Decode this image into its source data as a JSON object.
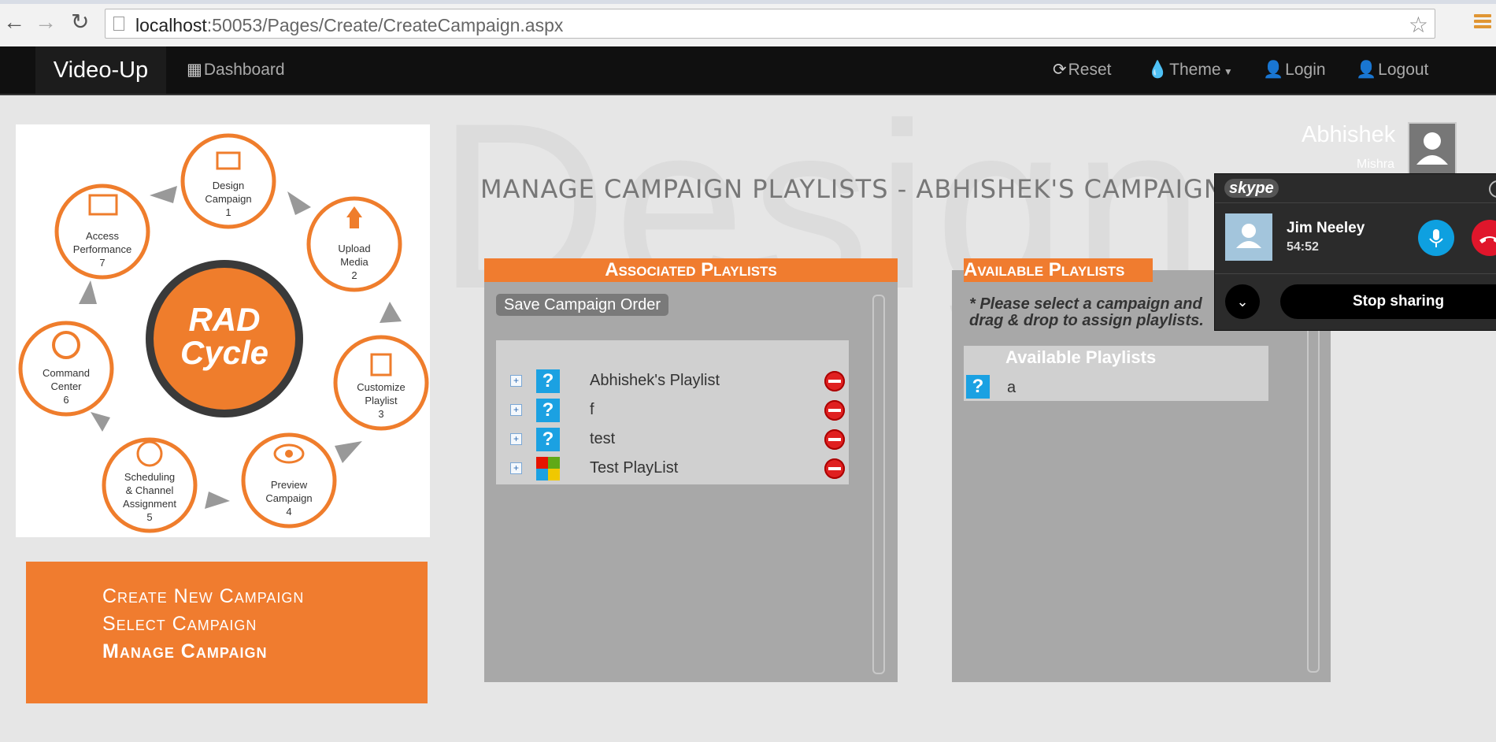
{
  "browser": {
    "url_host": "localhost",
    "url_rest": ":50053/Pages/Create/CreateCampaign.aspx",
    "back_icon": "arrow-left-icon",
    "forward_icon": "arrow-right-icon",
    "reload_icon": "reload-icon",
    "bookmark_icon": "star-icon"
  },
  "navbar": {
    "brand": "Video-Up",
    "dashboard": "Dashboard",
    "reset": "Reset",
    "theme": "Theme",
    "login": "Login",
    "logout": "Logout"
  },
  "watermark": "Design",
  "rad_image": {
    "center_line1": "RAD",
    "center_line2": "Cycle",
    "steps": [
      {
        "line1": "Design",
        "line2": "Campaign",
        "num": "1"
      },
      {
        "line1": "Upload",
        "line2": "Media",
        "num": "2"
      },
      {
        "line1": "Customize",
        "line2": "Playlist",
        "num": "3"
      },
      {
        "line1": "Preview",
        "line2": "Campaign",
        "num": "4"
      },
      {
        "line1": "Scheduling",
        "line2": "& Channel",
        "line3": "Assignment",
        "num": "5"
      },
      {
        "line1": "Command",
        "line2": "Center",
        "num": "6"
      },
      {
        "line1": "Access",
        "line2": "Performance",
        "num": "7"
      }
    ]
  },
  "campaign_menu": {
    "create": "Create New Campaign",
    "select": "Select Campaign",
    "manage": "Manage Campaign"
  },
  "page_title": "MANAGE CAMPAIGN PLAYLISTS    - ABHISHEK'S CAMPAIGN",
  "associated": {
    "header": "Associated Playlists",
    "save_button": "Save Campaign Order",
    "playlists": [
      {
        "name": "Abhishek's Playlist",
        "thumb": "?"
      },
      {
        "name": "f",
        "thumb": "?"
      },
      {
        "name": "test",
        "thumb": "?"
      },
      {
        "name": "Test PlayList",
        "thumb": "tiles"
      }
    ]
  },
  "available": {
    "header": "Available Playlists",
    "instruction_line1": "* Please select a campaign and",
    "instruction_line2": "drag & drop to assign playlists.",
    "box_header": "Available Playlists",
    "items": [
      {
        "name": "a",
        "thumb": "?"
      }
    ]
  },
  "user": {
    "name": "Abhishek",
    "sub": "Mishra"
  },
  "skype": {
    "logo": "skype",
    "caller": "Jim Neeley",
    "duration": "54:52",
    "stop_sharing": "Stop sharing"
  },
  "colors": {
    "accent": "#f07c2f",
    "navbar": "#101010",
    "panel": "#a8a8a8",
    "tile_blue": "#1ba1e2"
  }
}
